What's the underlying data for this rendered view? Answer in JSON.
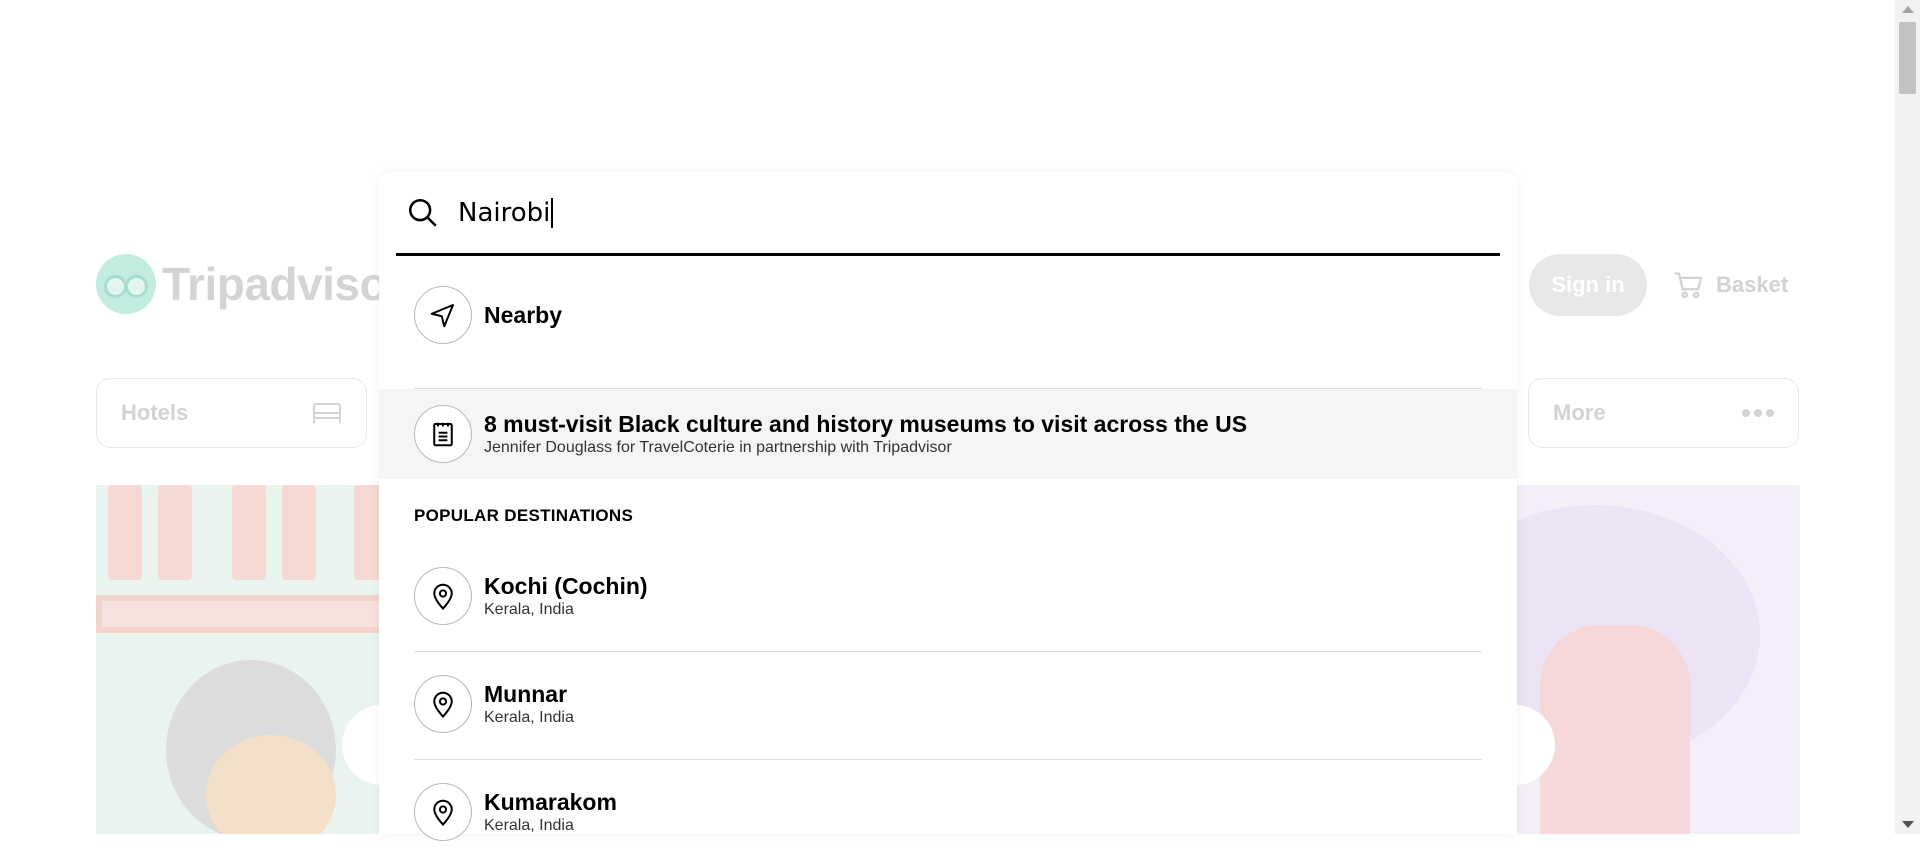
{
  "background": {
    "logo_text": "Tripadvisor",
    "sign_in_label": "Sign in",
    "basket_label": "Basket",
    "tabs": [
      {
        "label": "Hotels",
        "icon": "bed-icon"
      },
      {
        "label": "More",
        "icon": "ellipsis-icon"
      }
    ]
  },
  "search": {
    "value": "Nairobi",
    "icon": "search-icon"
  },
  "suggestions": {
    "nearby": {
      "title": "Nearby",
      "icon": "navigation-arrow-icon"
    },
    "article": {
      "title": "8 must-visit Black culture and history museums to visit across the US",
      "subtitle": "Jennifer Douglass for TravelCoterie in partnership with Tripadvisor",
      "icon": "article-icon"
    },
    "section_title": "POPULAR DESTINATIONS",
    "destinations": [
      {
        "title": "Kochi (Cochin)",
        "subtitle": "Kerala, India",
        "icon": "location-pin-icon"
      },
      {
        "title": "Munnar",
        "subtitle": "Kerala, India",
        "icon": "location-pin-icon"
      },
      {
        "title": "Kumarakom",
        "subtitle": "Kerala, India",
        "icon": "location-pin-icon"
      }
    ]
  },
  "colors": {
    "overlay_bg": "#ffffff",
    "highlight_row": "#f5f5f5",
    "underline": "#000000",
    "faded_text": "#d2d2d2"
  }
}
